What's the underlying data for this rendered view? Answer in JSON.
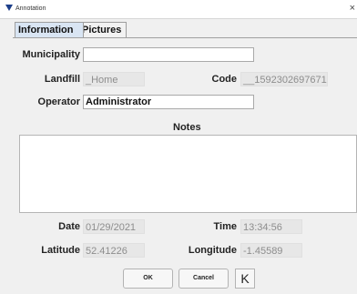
{
  "window": {
    "title": "Annotation",
    "close_glyph": "×"
  },
  "tabs": [
    {
      "label": "Information",
      "active": true
    },
    {
      "label": "Pictures",
      "active": false
    }
  ],
  "form": {
    "municipality": {
      "label": "Municipality",
      "value": ""
    },
    "landfill": {
      "label": "Landfill",
      "value": "_Home"
    },
    "code": {
      "label": "Code",
      "value": "__1592302697671"
    },
    "operator": {
      "label": "Operator",
      "value": "Administrator"
    },
    "notes": {
      "label": "Notes",
      "value": ""
    },
    "date": {
      "label": "Date",
      "value": "01/29/2021"
    },
    "time": {
      "label": "Time",
      "value": "13:34:56"
    },
    "latitude": {
      "label": "Latitude",
      "value": "52.41226"
    },
    "longitude": {
      "label": "Longitude",
      "value": "-1.45589"
    }
  },
  "buttons": {
    "ok": "OK",
    "cancel": "Cancel",
    "k": "K"
  },
  "icons": {
    "title_icon": "triangle-down-icon"
  },
  "colors": {
    "active_tab": "#d9e5f3",
    "readonly_bg": "#e7e7e7",
    "window_bg": "#f0f0f0"
  }
}
